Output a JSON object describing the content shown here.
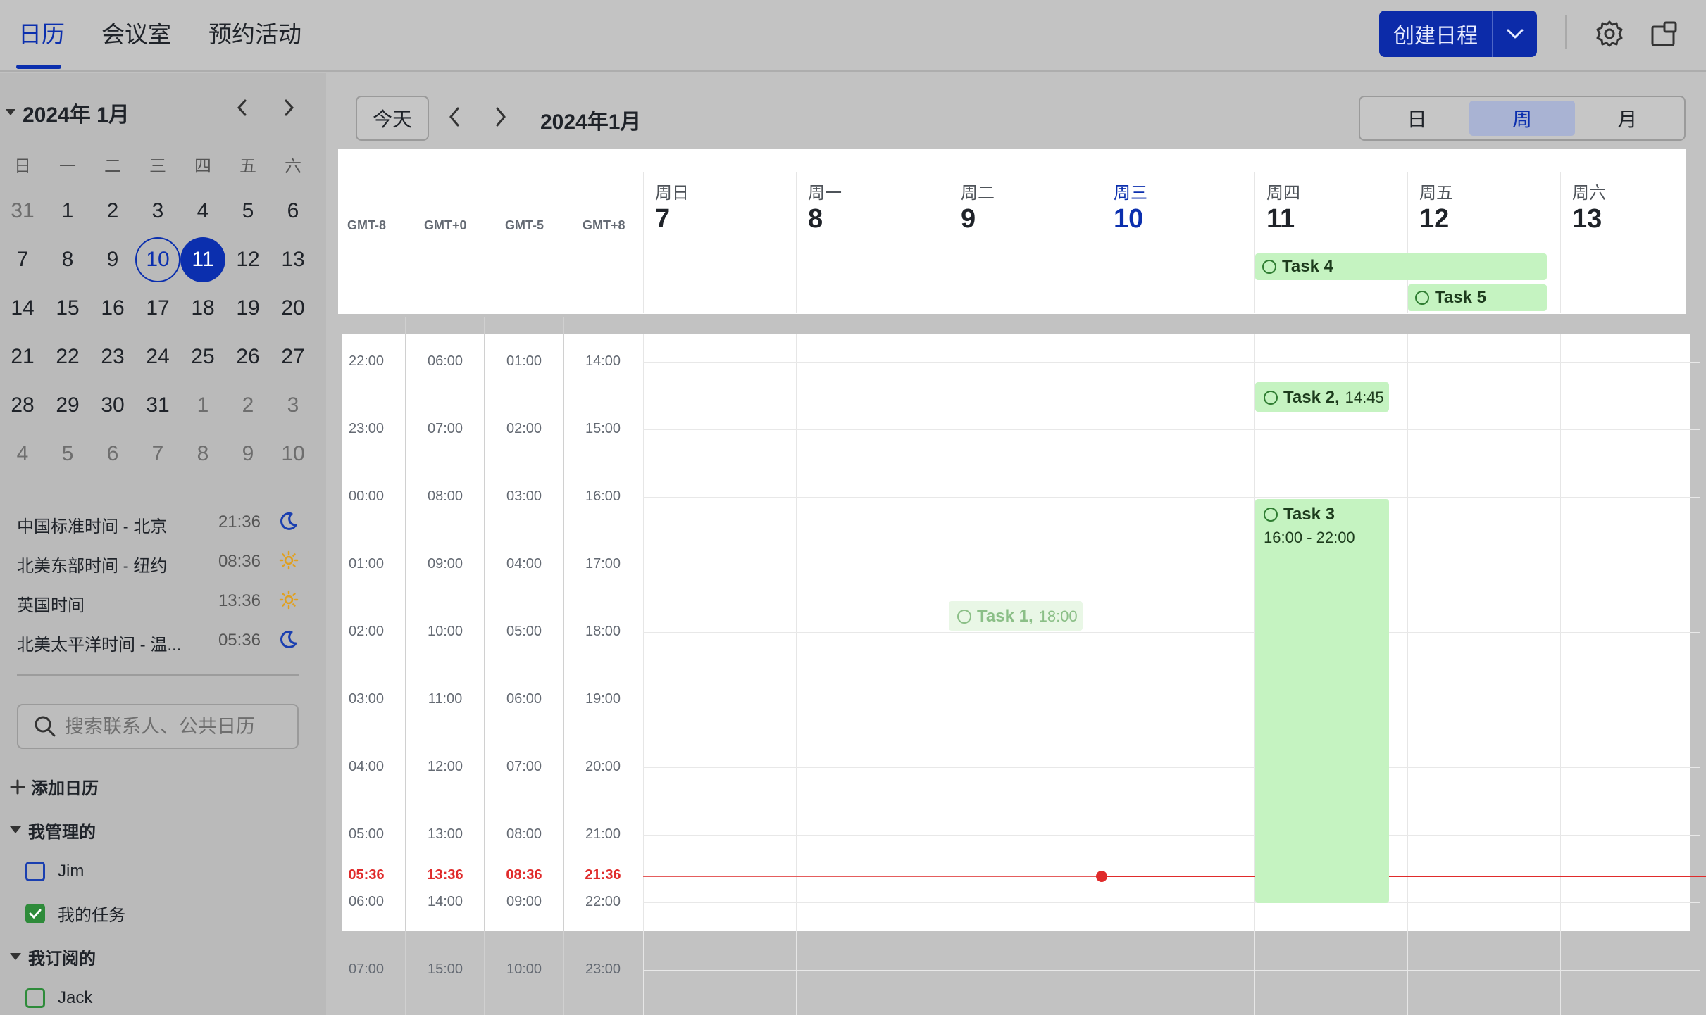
{
  "top_tabs": [
    "日历",
    "会议室",
    "预约活动"
  ],
  "create_button": "创建日程",
  "mini_calendar": {
    "title": "2024年 1月",
    "weekdays": [
      "日",
      "一",
      "二",
      "三",
      "四",
      "五",
      "六"
    ],
    "weeks": [
      [
        "31",
        "1",
        "2",
        "3",
        "4",
        "5",
        "6"
      ],
      [
        "7",
        "8",
        "9",
        "10",
        "11",
        "12",
        "13"
      ],
      [
        "14",
        "15",
        "16",
        "17",
        "18",
        "19",
        "20"
      ],
      [
        "21",
        "22",
        "23",
        "24",
        "25",
        "26",
        "27"
      ],
      [
        "28",
        "29",
        "30",
        "31",
        "1",
        "2",
        "3"
      ],
      [
        "4",
        "5",
        "6",
        "7",
        "8",
        "9",
        "10"
      ]
    ],
    "today": "10",
    "selected": "11"
  },
  "timezones": [
    {
      "name": "中国标准时间 - 北京",
      "time": "21:36",
      "icon": "moon-icon"
    },
    {
      "name": "北美东部时间 - 纽约",
      "time": "08:36",
      "icon": "sun-icon"
    },
    {
      "name": "英国时间",
      "time": "13:36",
      "icon": "sun-icon"
    },
    {
      "name": "北美太平洋时间 - 温...",
      "time": "05:36",
      "icon": "moon-icon"
    }
  ],
  "search": {
    "placeholder": "搜索联系人、公共日历"
  },
  "add_calendar": "添加日历",
  "managed": {
    "title": "我管理的",
    "items": [
      {
        "label": "Jim",
        "checked": false,
        "color": "#1a3fb0"
      },
      {
        "label": "我的任务",
        "checked": true,
        "color": "#2e8b3a"
      }
    ]
  },
  "subscribed": {
    "title": "我订阅的",
    "items": [
      {
        "label": "Jack",
        "checked": false,
        "color": "#2e8b3a"
      }
    ]
  },
  "toolbar": {
    "today": "今天",
    "range_title": "2024年1月",
    "views": [
      "日",
      "周",
      "月"
    ],
    "active_view": "周"
  },
  "gmt_labels": [
    "GMT-8",
    "GMT+0",
    "GMT-5",
    "GMT+8"
  ],
  "days": [
    {
      "weekday": "周日",
      "date": "7"
    },
    {
      "weekday": "周一",
      "date": "8"
    },
    {
      "weekday": "周二",
      "date": "9"
    },
    {
      "weekday": "周三",
      "date": "10",
      "today": true
    },
    {
      "weekday": "周四",
      "date": "11"
    },
    {
      "weekday": "周五",
      "date": "12"
    },
    {
      "weekday": "周六",
      "date": "13"
    }
  ],
  "time_rows": [
    [
      "22:00",
      "06:00",
      "01:00",
      "14:00"
    ],
    [
      "23:00",
      "07:00",
      "02:00",
      "15:00"
    ],
    [
      "00:00",
      "08:00",
      "03:00",
      "16:00"
    ],
    [
      "01:00",
      "09:00",
      "04:00",
      "17:00"
    ],
    [
      "02:00",
      "10:00",
      "05:00",
      "18:00"
    ],
    [
      "03:00",
      "11:00",
      "06:00",
      "19:00"
    ],
    [
      "04:00",
      "12:00",
      "07:00",
      "20:00"
    ],
    [
      "05:00",
      "13:00",
      "08:00",
      "21:00"
    ],
    [
      "06:00",
      "14:00",
      "09:00",
      "22:00"
    ],
    [
      "07:00",
      "15:00",
      "10:00",
      "23:00"
    ]
  ],
  "now_row": [
    "05:36",
    "13:36",
    "08:36",
    "21:36"
  ],
  "events": {
    "task4": {
      "title": "Task 4"
    },
    "task5": {
      "title": "Task 5"
    },
    "task2": {
      "title": "Task 2,",
      "time": "14:45"
    },
    "task3": {
      "title": "Task 3",
      "time": "16:00 - 22:00"
    },
    "task1": {
      "title": "Task 1,",
      "time": "18:00"
    }
  }
}
